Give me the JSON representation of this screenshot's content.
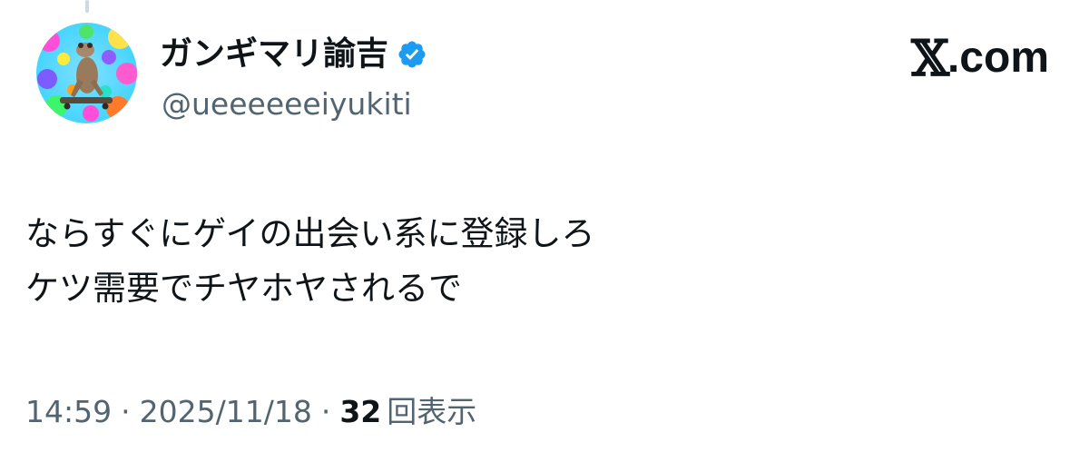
{
  "author": {
    "display_name": "ガンギマリ諭吉",
    "handle": "@ueeeeeeiyukiti",
    "verified": true,
    "avatar_icon": "frog-on-skateboard-avatar",
    "verified_icon": "verified-badge-icon",
    "verified_color": "#1d9bf0"
  },
  "brand": {
    "x": "𝕏",
    "rest": ".com"
  },
  "tweet": {
    "lines": [
      "ならすぐにゲイの出会い系に登録しろ",
      "ケツ需要でチヤホヤされるで"
    ]
  },
  "meta": {
    "time": "14:59",
    "separator": "·",
    "date": "2025/11/18",
    "view_count": "32",
    "view_label": "回表示"
  },
  "colors": {
    "text": "#0f1419",
    "secondary": "#536471"
  }
}
